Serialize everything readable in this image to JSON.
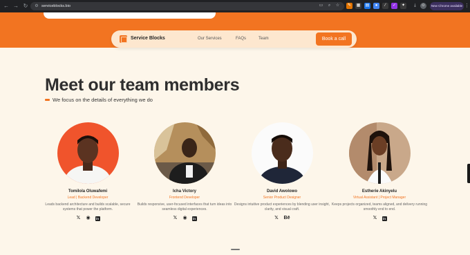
{
  "browser": {
    "url": "serviceblocks.bio",
    "chrome_badge": "New Chrome available",
    "nav_icons": [
      "back-arrow",
      "forward-arrow",
      "reload"
    ],
    "omnibox_icons": [
      "cast",
      "zoom",
      "bookmark-star"
    ]
  },
  "navbar": {
    "brand": "Service Blocks",
    "links": [
      "Our Services",
      "FAQs",
      "Team"
    ],
    "cta": "Book a call"
  },
  "section": {
    "title": "Meet our team members",
    "subtitle": "We focus on the details of everything we do"
  },
  "team": [
    {
      "name": "Tomilola Oluwafemi",
      "role": "Lead | Backend Developer",
      "description": "Leads backend architecture and builds scalable, secure systems that power the platform.",
      "socials": [
        "x",
        "github",
        "linkedin"
      ]
    },
    {
      "name": "Icha Victory",
      "role": "Frontend Developer",
      "description": "Builds responsive, user-focused interfaces that turn ideas into seamless digital experiences.",
      "socials": [
        "x",
        "github",
        "linkedin"
      ]
    },
    {
      "name": "David Awolowo",
      "role": "Senior Product Designer",
      "description": "Designs intuitive product experiences by blending user insight, clarity, and visual craft.",
      "socials": [
        "x",
        "behance"
      ]
    },
    {
      "name": "Estherie Akinyelu",
      "role": "Virtual Assistant | Project Manager",
      "description": "Keeps projects organized, teams aligned, and delivery running smoothly end to end.",
      "socials": [
        "x",
        "linkedin"
      ]
    }
  ],
  "colors": {
    "accent": "#f27421",
    "background": "#fdf6ea",
    "heading": "#2f2f2f"
  },
  "glyphs": {
    "x": "𝕏",
    "github": "◉",
    "linkedin": "in",
    "behance": "Bē"
  }
}
